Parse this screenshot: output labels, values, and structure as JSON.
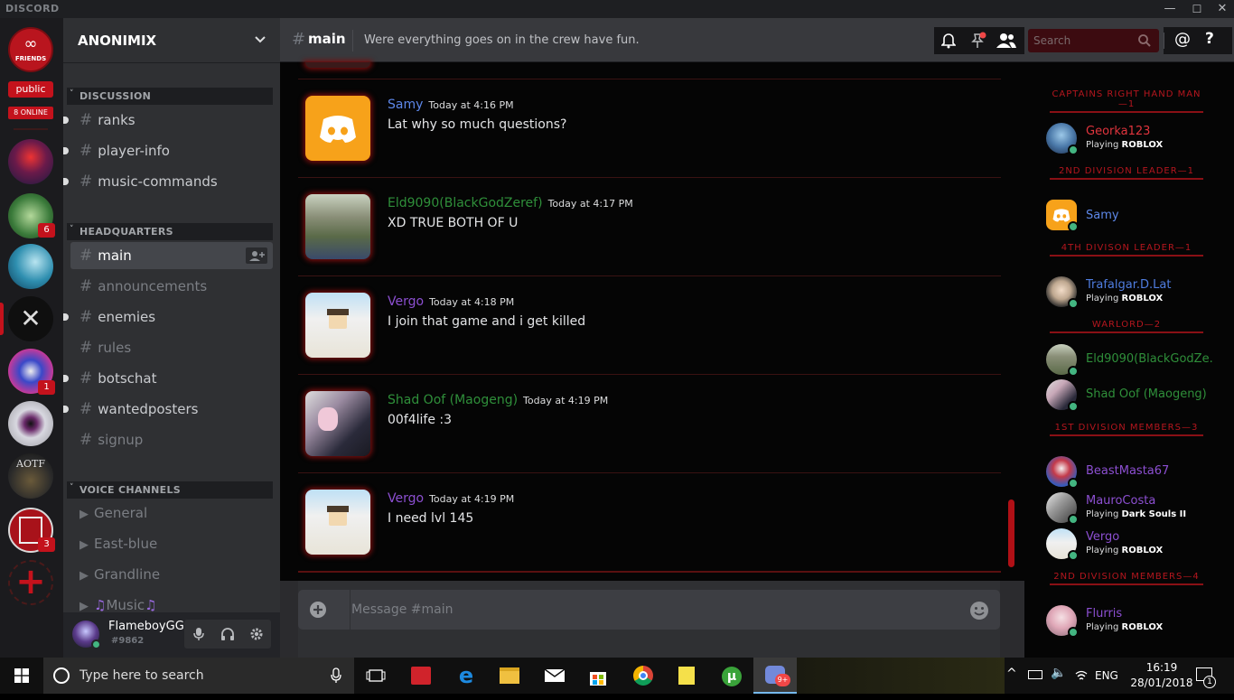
{
  "titlebar": {
    "brand": "DISCORD",
    "minimize": "—",
    "maximize": "☐",
    "close": "✕"
  },
  "guilds": {
    "friends_label": "FRIENDS",
    "public_label": "public",
    "online_label": "8 ONLINE",
    "badges": [
      "6",
      "1",
      "3"
    ],
    "aotf_label": "AOTF"
  },
  "server": {
    "name": "ANONIMIX"
  },
  "categories": {
    "discussion": "DISCUSSION",
    "headquarters": "HEADQUARTERS",
    "voice": "VOICE CHANNELS"
  },
  "discussion_channels": [
    "ranks",
    "player-info",
    "music-commands"
  ],
  "hq_channels": [
    "main",
    "announcements",
    "enemies",
    "rules",
    "botschat",
    "wantedposters",
    "signup"
  ],
  "voice_channels": [
    "General",
    "East-blue",
    "Grandline",
    "Music"
  ],
  "user": {
    "name": "FlameboyGG",
    "tag": "#9862"
  },
  "chat_header": {
    "channel": "main",
    "topic": "Were everything goes on in the crew have fun.",
    "search_placeholder": "Search"
  },
  "messages": [
    {
      "author": "Samy",
      "time": "Today at 4:16 PM",
      "text": "Lat why so much questions?",
      "color": "#5d87e8"
    },
    {
      "author": "Eld9090(BlackGodZeref)",
      "time": "Today at 4:17 PM",
      "text": "XD TRUE BOTH OF U",
      "color": "#2f8f3a"
    },
    {
      "author": "Vergo",
      "time": "Today at 4:18 PM",
      "text": "I join that game and i get killed",
      "color": "#8c4fd1"
    },
    {
      "author": "Shad Oof (Maogeng)",
      "time": "Today at 4:19 PM",
      "text": "00f4life :3",
      "color": "#2f8f3a"
    },
    {
      "author": "Vergo",
      "time": "Today at 4:19 PM",
      "text": "I need lvl 145",
      "color": "#8c4fd1"
    }
  ],
  "composer": {
    "placeholder": "Message #main"
  },
  "members": {
    "roles": [
      "CAPTAINS RIGHT HAND MAN—1",
      "2ND DIVISION LEADER—1",
      "4TH DIVISON LEADER—1",
      "WARLORD—2",
      "1ST DIVISION MEMBERS—3",
      "2ND DIVISION MEMBERS—4"
    ],
    "list": [
      {
        "name": "Georka123",
        "activity_prefix": "Playing ",
        "activity": "ROBLOX",
        "color": "#e0343d"
      },
      {
        "name": "Samy",
        "activity_prefix": "",
        "activity": "",
        "color": "#5d87e8"
      },
      {
        "name": "Trafalgar.D.Lat",
        "activity_prefix": "Playing ",
        "activity": "ROBLOX",
        "color": "#4f7de0"
      },
      {
        "name": "Eld9090(BlackGodZe...",
        "activity_prefix": "",
        "activity": "",
        "color": "#2f8f3a"
      },
      {
        "name": "Shad Oof (Maogeng)",
        "activity_prefix": "",
        "activity": "",
        "color": "#2f8f3a"
      },
      {
        "name": "BeastMasta67",
        "activity_prefix": "",
        "activity": "",
        "color": "#8c4fd1"
      },
      {
        "name": "MauroCosta",
        "activity_prefix": "Playing ",
        "activity": "Dark Souls II",
        "color": "#8c4fd1"
      },
      {
        "name": "Vergo",
        "activity_prefix": "Playing ",
        "activity": "ROBLOX",
        "color": "#8c4fd1"
      },
      {
        "name": "Flurris",
        "activity_prefix": "Playing ",
        "activity": "ROBLOX",
        "color": "#8c4fd1"
      }
    ]
  },
  "taskbar": {
    "search_placeholder": "Type here to search",
    "time": "16:19",
    "date": "28/01/2018",
    "lang": "ENG",
    "notif_count": "1",
    "discord_badge": "9+"
  }
}
